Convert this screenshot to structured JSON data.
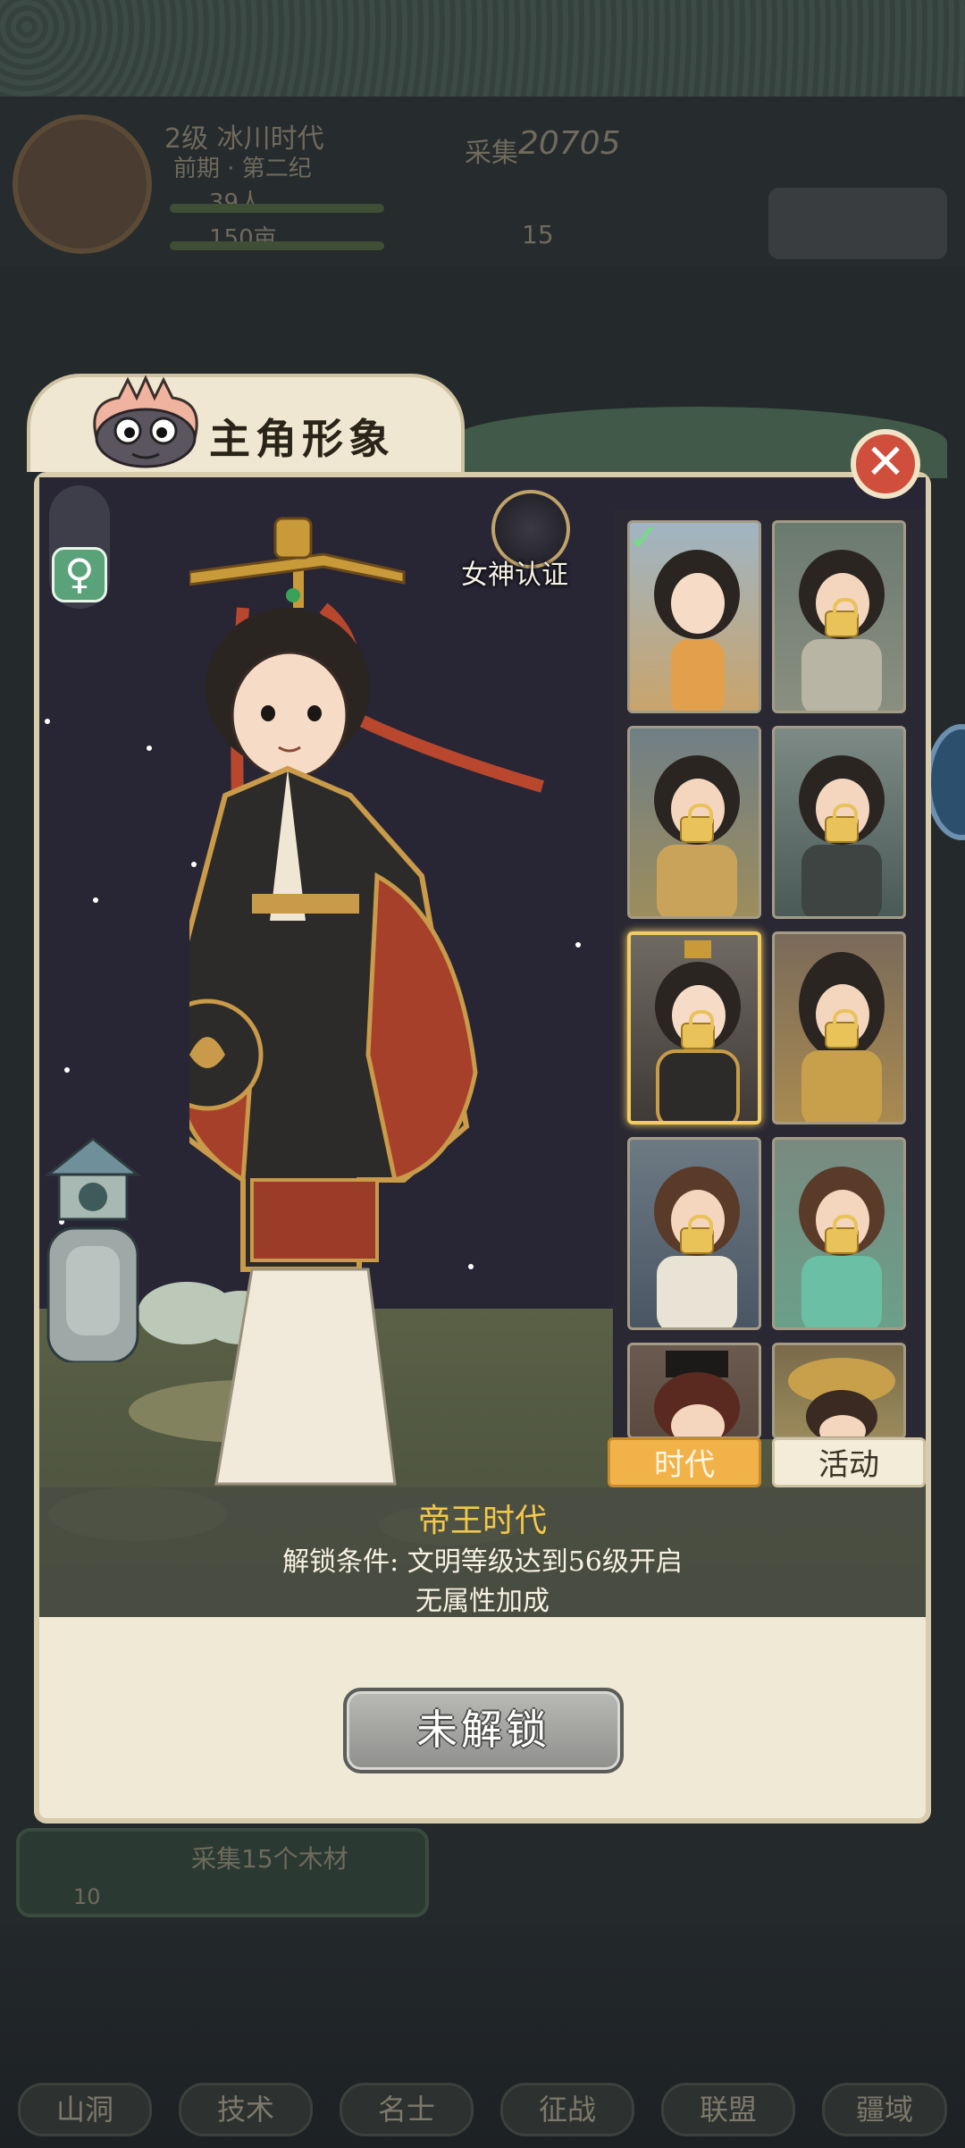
{
  "background": {
    "level_label": "2级 冰川时代",
    "period_label": "前期 · 第二纪",
    "population": "39人",
    "land": "150亩",
    "resource_value": "20705",
    "resource_label": "采集",
    "green_count": "15",
    "quest_text": "采集15个木材",
    "quest_count": "10",
    "bottom_tabs": [
      "山洞",
      "技术",
      "名士",
      "征战",
      "联盟",
      "疆域"
    ]
  },
  "modal": {
    "title": "主角形象",
    "close_icon": "close-icon",
    "gender_icon": "♀",
    "goddess_label": "女神认证",
    "tabs": {
      "active": "时代",
      "idle": "活动"
    },
    "selected": {
      "name": "帝王时代",
      "unlock_condition": "解锁条件: 文明等级达到56级开启",
      "bonus": "无属性加成"
    },
    "action_button": "未解锁",
    "grid": {
      "count": 10,
      "selected_index": 4,
      "equipped_index": 0
    }
  },
  "colors": {
    "accent_gold": "#f2b24a",
    "title_gold": "#f3c84a",
    "close_red": "#cf4e3c",
    "female_green": "#59a27a"
  }
}
